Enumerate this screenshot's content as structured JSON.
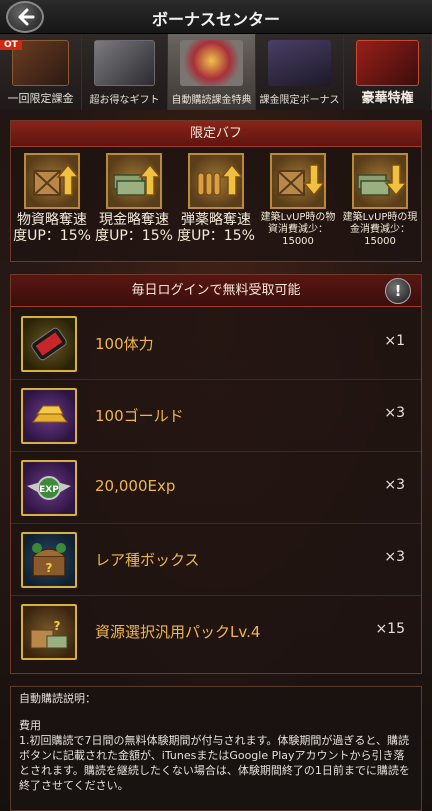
{
  "header": {
    "title": "ボーナスセンター"
  },
  "tabs": [
    {
      "label": "一回限定課金",
      "badge": "OT",
      "active": false
    },
    {
      "label": "超お得なギフト",
      "active": false
    },
    {
      "label": "自動購読課金特典",
      "active": true
    },
    {
      "label": "課金限定ボーナス",
      "active": false
    },
    {
      "label": "豪華特権",
      "active": false
    }
  ],
  "buff_panel": {
    "title": "限定バフ",
    "items": [
      {
        "icon": "crate-up-icon",
        "line1": "物資略奪速",
        "line2": "度UP：15%"
      },
      {
        "icon": "cash-up-icon",
        "line1": "現金略奪速",
        "line2": "度UP：15%"
      },
      {
        "icon": "ammo-up-icon",
        "line1": "弾薬略奪速",
        "line2": "度UP：15%"
      },
      {
        "icon": "crate-down-icon",
        "line1": "建築LvUP時の物",
        "line2": "資消費減少：",
        "line3": "15000"
      },
      {
        "icon": "cash-down-icon",
        "line1": "建築LvUP時の現",
        "line2": "金消費減少：",
        "line3": "15000"
      }
    ]
  },
  "daily_panel": {
    "title": "毎日ログインで無料受取可能",
    "info_symbol": "!",
    "rewards": [
      {
        "icon": "energy-drink-icon",
        "name": "100体力",
        "qty": "×1"
      },
      {
        "icon": "gold-bar-icon",
        "name": "100ゴールド",
        "qty": "×3"
      },
      {
        "icon": "exp-badge-icon",
        "name": "20,000Exp",
        "qty": "×3"
      },
      {
        "icon": "treasure-chest-icon",
        "name": "レア種ボックス",
        "qty": "×3"
      },
      {
        "icon": "resource-pack-icon",
        "name": "資源選択汎用パックLv.4",
        "qty": "×15"
      }
    ]
  },
  "description": {
    "heading": "自動購読説明：",
    "subheading": "費用",
    "body": "1.初回購読で7日間の無料体験期間が付与されます。体験期間が過ぎると、購読ボタンに記載された金額が、iTunesまたはGoogle Playアカウントから引き落とされます。購読を継続したくない場合は、体験期間終了の1日前までに購読を終了させてください。"
  },
  "colors": {
    "accent_red": "#8a241a",
    "reward_text": "#f0b64a",
    "gold_border": "#d8b23a"
  }
}
